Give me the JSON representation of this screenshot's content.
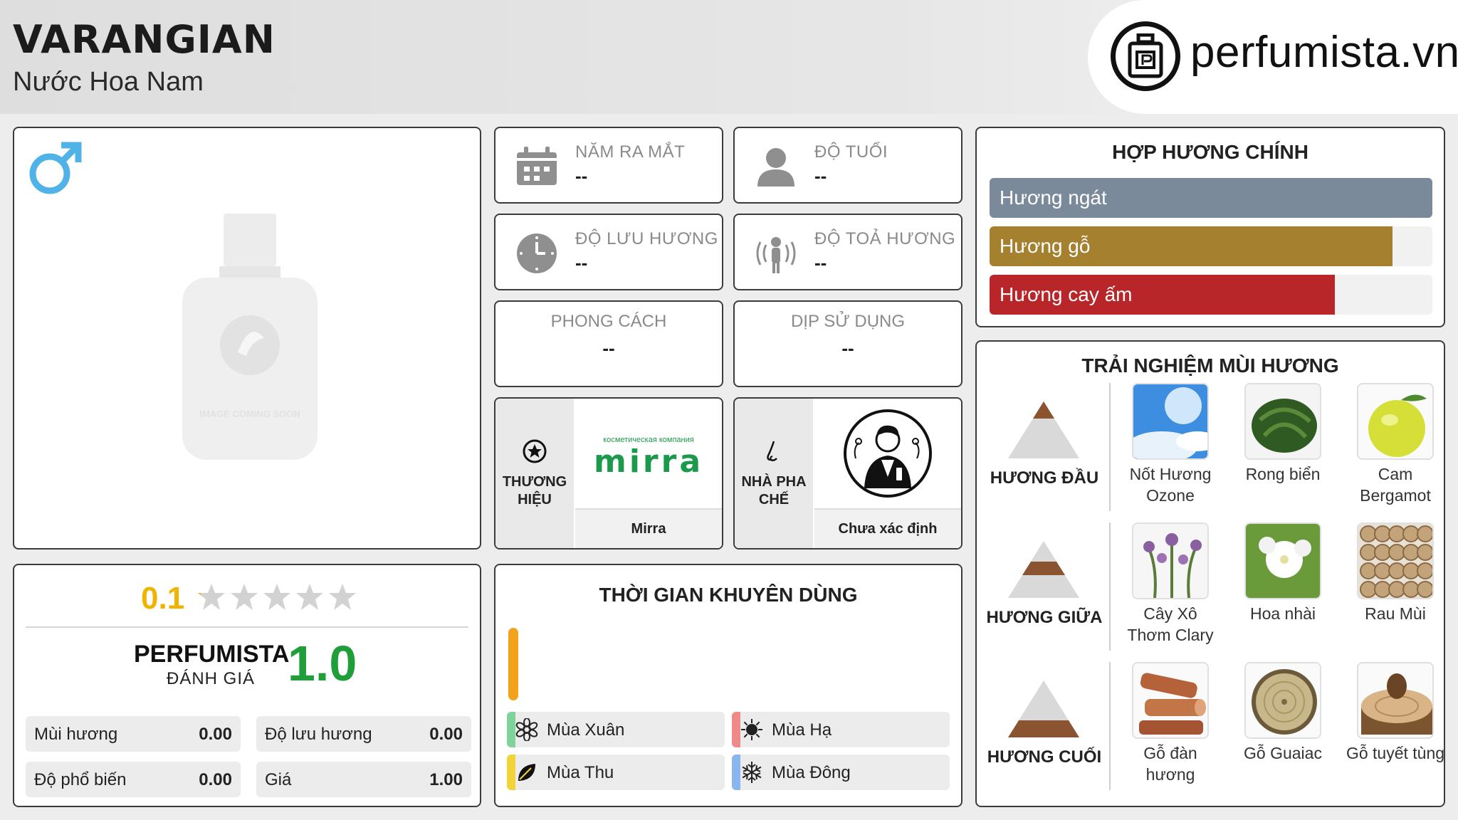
{
  "header": {
    "title": "VARANGIAN",
    "subtitle": "Nước Hoa Nam",
    "logo_text": "perfumista.vn",
    "logo_icon": "perfume-bottle-icon"
  },
  "product": {
    "gender_icon": "male-symbol-icon",
    "gender_color": "#4fb3e8",
    "image_placeholder_text": "IMAGE COMING SOON"
  },
  "info": {
    "launch_year": {
      "label": "NĂM RA MẮT",
      "value": "--",
      "icon": "calendar-icon"
    },
    "age": {
      "label": "ĐỘ TUỔI",
      "value": "--",
      "icon": "person-icon"
    },
    "longevity": {
      "label": "ĐỘ LƯU HƯƠNG",
      "value": "--",
      "icon": "clock-icon"
    },
    "sillage": {
      "label": "ĐỘ TOẢ HƯƠNG",
      "value": "--",
      "icon": "diffusion-person-icon"
    },
    "style": {
      "label": "PHONG CÁCH",
      "value": "--"
    },
    "occasion": {
      "label": "DỊP SỬ DỤNG",
      "value": "--"
    },
    "brand": {
      "side_label": "THƯƠNG HIỆU",
      "logo_caption": "косметическая компания",
      "logo_word": "mirra",
      "name": "Mirra",
      "icon": "star-circle-icon"
    },
    "perfumer": {
      "side_label": "NHÀ PHA CHẾ",
      "name": "Chưa xác định",
      "icon": "nose-icon"
    }
  },
  "accords": {
    "title": "HỢP HƯƠNG CHÍNH",
    "items": [
      {
        "name": "Hương ngát",
        "color": "#7a8a9b",
        "level": 1.0
      },
      {
        "name": "Hương gỗ",
        "color": "#a4802f",
        "level": 0.91
      },
      {
        "name": "Hương cay ấm",
        "color": "#b8262a",
        "level": 0.78
      }
    ]
  },
  "notes": {
    "title": "TRẢI NGHIỆM MÙI HƯƠNG",
    "tiers": [
      {
        "label": "HƯƠNG ĐẦU",
        "items": [
          {
            "name": "Nốt Hương Ozone",
            "icon": "sky-icon"
          },
          {
            "name": "Rong biển",
            "icon": "seaweed-icon"
          },
          {
            "name": "Cam Bergamot",
            "icon": "bergamot-icon"
          }
        ]
      },
      {
        "label": "HƯƠNG GIỮA",
        "items": [
          {
            "name": "Cây Xô Thơm Clary",
            "icon": "clary-sage-icon"
          },
          {
            "name": "Hoa nhài",
            "icon": "jasmine-icon"
          },
          {
            "name": "Rau Mùi",
            "icon": "coriander-icon"
          }
        ]
      },
      {
        "label": "HƯƠNG CUỐI",
        "items": [
          {
            "name": "Gỗ đàn hương",
            "icon": "sandalwood-icon"
          },
          {
            "name": "Gỗ Guaiac",
            "icon": "guaiac-wood-icon"
          },
          {
            "name": "Gỗ tuyết tùng",
            "icon": "cedar-icon"
          }
        ]
      }
    ]
  },
  "rating": {
    "user_score": "0.1",
    "stars_filled": 0.02,
    "pf_label": "PERFUMISTA",
    "pf_sub": "ĐÁNH GIÁ",
    "pf_score": "1.0",
    "metrics": [
      {
        "label": "Mùi hương",
        "value": "0.00"
      },
      {
        "label": "Độ lưu hương",
        "value": "0.00"
      },
      {
        "label": "Độ phổ biến",
        "value": "0.00"
      },
      {
        "label": "Giá",
        "value": "1.00"
      }
    ]
  },
  "seasons": {
    "title": "THỜI GIAN KHUYÊN DÙNG",
    "items": [
      {
        "label": "Mùa Xuân",
        "color": "#7fd39a",
        "icon": "flower-icon"
      },
      {
        "label": "Mùa Hạ",
        "color": "#f08a8a",
        "icon": "sun-icon"
      },
      {
        "label": "Mùa Thu",
        "color": "#f0d43a",
        "icon": "leaf-icon"
      },
      {
        "label": "Mùa Đông",
        "color": "#8ab6f0",
        "icon": "snowflake-icon"
      }
    ]
  }
}
